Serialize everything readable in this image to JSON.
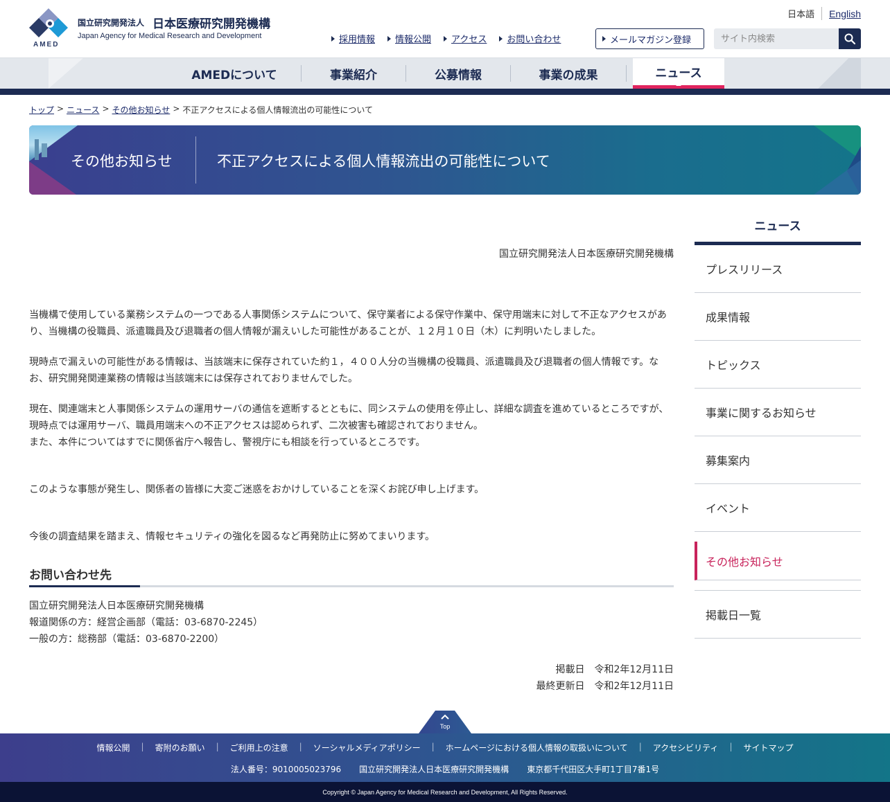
{
  "header": {
    "org_name_small": "国立研究開発法人",
    "org_name_big": "日本医療研究開発機構",
    "org_name_en": "Japan Agency for Medical Research and Development",
    "logo_text": "AMED",
    "lang_ja": "日本語",
    "lang_en": "English",
    "util_links": [
      "採用情報",
      "情報公開",
      "アクセス",
      "お問い合わせ"
    ],
    "mail_magazine": "メールマガジン登録",
    "search_placeholder": "サイト内検索"
  },
  "gnav": [
    {
      "label": "AMEDについて",
      "active": false
    },
    {
      "label": "事業紹介",
      "active": false
    },
    {
      "label": "公募情報",
      "active": false
    },
    {
      "label": "事業の成果",
      "active": false
    },
    {
      "label": "ニュース",
      "active": true
    }
  ],
  "breadcrumb": {
    "items": [
      "トップ",
      "ニュース",
      "その他お知らせ"
    ],
    "current": "不正アクセスによる個人情報流出の可能性について",
    "separator": ">"
  },
  "banner": {
    "category": "その他お知らせ",
    "title": "不正アクセスによる個人情報流出の可能性について"
  },
  "article": {
    "org": "国立研究開発法人日本医療研究開発機構",
    "paragraphs": [
      "当機構で使用している業務システムの一つである人事関係システムについて、保守業者による保守作業中、保守用端末に対して不正なアクセスがあり、当機構の役職員、派遣職員及び退職者の個人情報が漏えいした可能性があることが、１２月１０日（木）に判明いたしました。",
      "現時点で漏えいの可能性がある情報は、当該端末に保存されていた約１，４００人分の当機構の役職員、派遣職員及び退職者の個人情報です。なお、研究開発関連業務の情報は当該端末には保存されておりませんでした。",
      "現在、関連端末と人事関係システムの運用サーバの通信を遮断するとともに、同システムの使用を停止し、詳細な調査を進めているところですが、現時点では運用サーバ、職員用端末への不正アクセスは認められず、二次被害も確認されておりません。",
      "また、本件についてはすでに関係省庁へ報告し、警視庁にも相談を行っているところです。",
      "このような事態が発生し、関係者の皆様に大変ご迷惑をおかけしていることを深くお詫び申し上げます。",
      "今後の調査結果を踏まえ、情報セキュリティの強化を図るなど再発防止に努めてまいります。"
    ],
    "contact_heading": "お問い合わせ先",
    "contact_lines": [
      "国立研究開発法人日本医療研究開発機構",
      "報道関係の方：経営企画部（電話：03-6870-2245）",
      "一般の方：総務部（電話：03-6870-2200）"
    ],
    "posted": "掲載日　令和2年12月11日",
    "updated": "最終更新日　令和2年12月11日"
  },
  "sidebar": {
    "heading": "ニュース",
    "items": [
      {
        "label": "プレスリリース",
        "active": false
      },
      {
        "label": "成果情報",
        "active": false
      },
      {
        "label": "トピックス",
        "active": false
      },
      {
        "label": "事業に関するお知らせ",
        "active": false
      },
      {
        "label": "募集案内",
        "active": false
      },
      {
        "label": "イベント",
        "active": false
      },
      {
        "label": "その他お知らせ",
        "active": true
      },
      {
        "label": "掲載日一覧",
        "active": false
      }
    ]
  },
  "pagetop": "Top",
  "footer": {
    "links": [
      "情報公開",
      "寄附のお願い",
      "ご利用上の注意",
      "ソーシャルメディアポリシー",
      "ホームページにおける個人情報の取扱いについて",
      "アクセシビリティ",
      "サイトマップ"
    ],
    "corp_number": "法人番号：9010005023796",
    "org": "国立研究開発法人日本医療研究開発機構",
    "address": "東京都千代田区大手町1丁目7番1号",
    "copyright": "Copyright © Japan Agency for Medical Research and Development, All Rights Reserved."
  },
  "colors": {
    "navy": "#1c2b52",
    "accent_pink": "#e0245e",
    "sidebar_active": "#c8235b"
  }
}
